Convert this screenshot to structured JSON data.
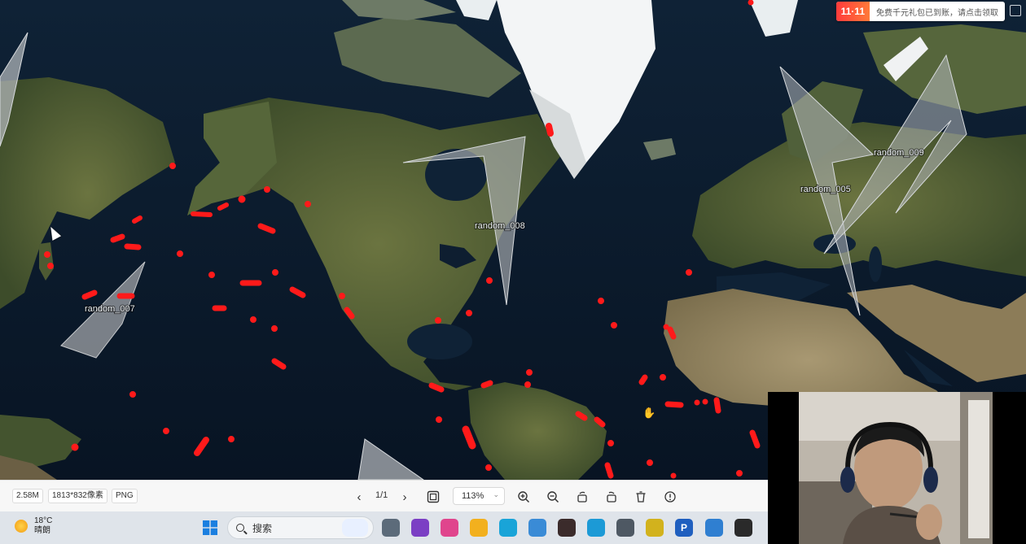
{
  "map": {
    "polygon_labels": [
      "random_007",
      "random_008",
      "random_005",
      "random_009"
    ],
    "promo": {
      "badge": "11·11",
      "text": "免费千元礼包已到账，请点击领取"
    }
  },
  "viewer_toolbar": {
    "file_size": "2.58M",
    "dimensions": "1813*832像素",
    "format": "PNG",
    "page_indicator": "1/1",
    "zoom": "113%"
  },
  "taskbar": {
    "weather": {
      "temperature": "18°C",
      "condition": "晴朗"
    },
    "search_placeholder": "搜索"
  },
  "colors": {
    "marker": "#ff1a1a",
    "polygon_fill": "#b4b8bc",
    "ocean": "#0b1b2e",
    "land": "#4a5a32"
  }
}
